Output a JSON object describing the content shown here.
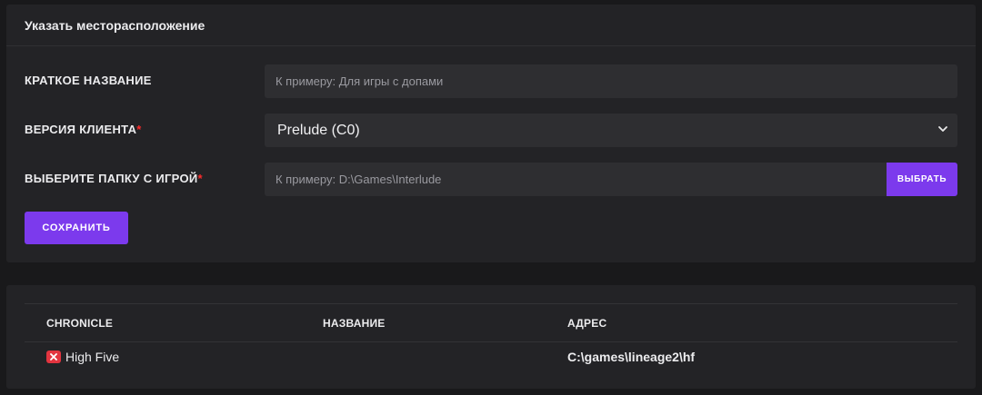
{
  "form": {
    "title": "Указать месторасположение",
    "short_name": {
      "label": "КРАТКОЕ НАЗВАНИЕ",
      "placeholder": "К примеру: Для игры с допами",
      "value": ""
    },
    "client_version": {
      "label": "ВЕРСИЯ КЛИЕНТА",
      "required_mark": "*",
      "selected": "Prelude (C0)"
    },
    "game_folder": {
      "label": "ВЫБЕРИТЕ ПАПКУ С ИГРОЙ",
      "required_mark": "*",
      "placeholder": "К примеру: D:\\Games\\Interlude",
      "value": ""
    },
    "choose_button": "ВЫБРАТЬ",
    "save_button": "СОХРАНИТЬ"
  },
  "table": {
    "columns": [
      "CHRONICLE",
      "НАЗВАНИЕ",
      "АДРЕС"
    ],
    "rows": [
      {
        "chronicle": "High Five",
        "name": "",
        "address": "C:\\games\\lineage2\\hf"
      }
    ]
  },
  "colors": {
    "accent": "#7c3aed",
    "required": "#ff2b2b",
    "delete": "#e3343f"
  },
  "icons": {
    "select_arrow": "chevron-down-icon",
    "row_delete": "close-icon"
  }
}
